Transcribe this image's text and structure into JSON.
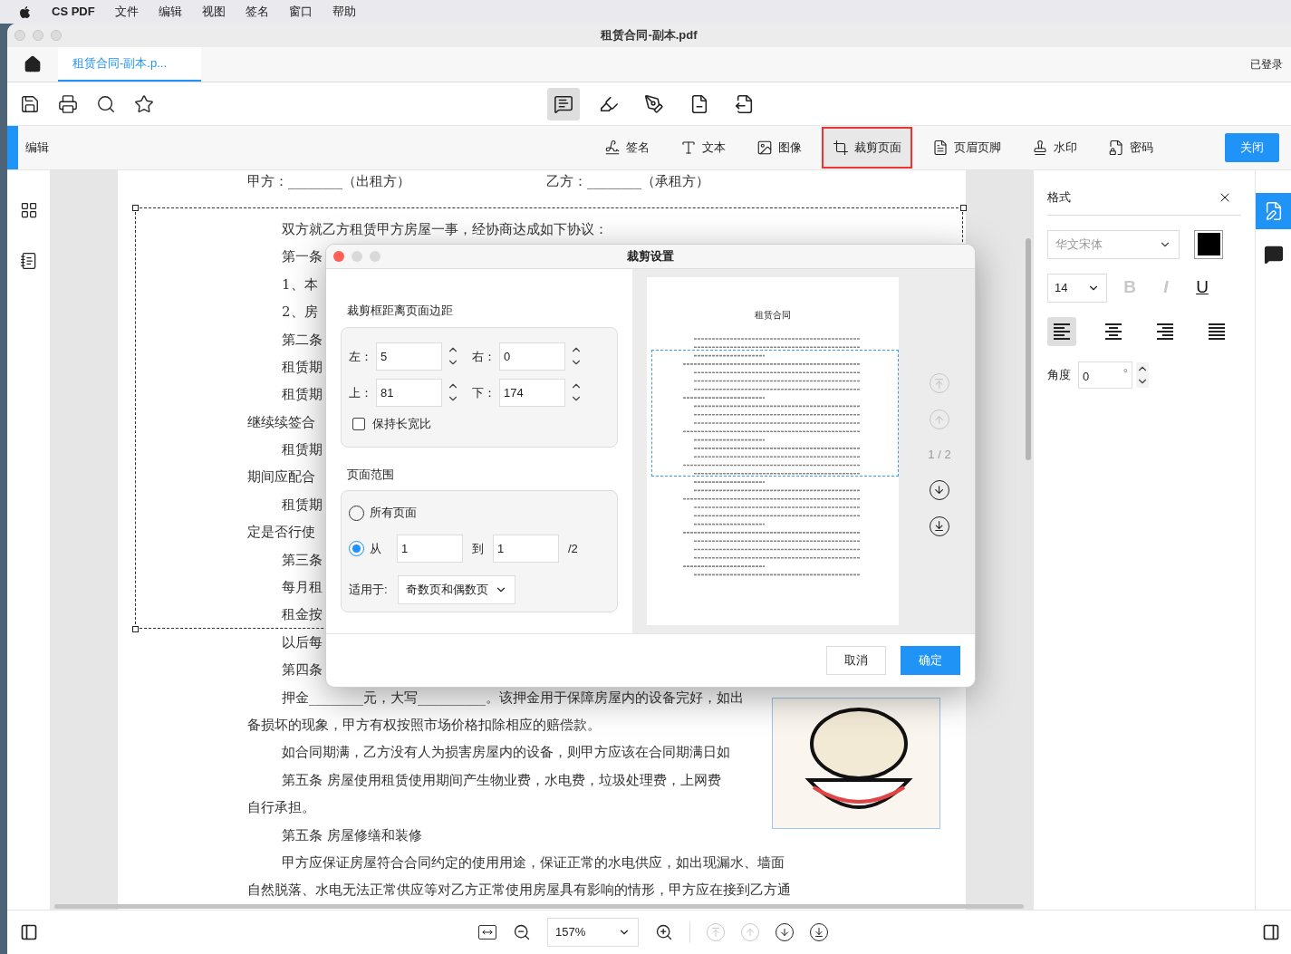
{
  "menu_bar": {
    "app": "CS PDF",
    "items": [
      "文件",
      "编辑",
      "视图",
      "签名",
      "窗口",
      "帮助"
    ]
  },
  "window": {
    "title": "租赁合同-副本.pdf"
  },
  "tabs": [
    {
      "label": "租赁合同-副本.p...",
      "selected": true
    }
  ],
  "account": "已登录",
  "toolbar": {
    "mode_tools": [
      {
        "kind": "comment",
        "selected": true
      },
      {
        "kind": "highlight",
        "selected": false
      },
      {
        "kind": "pen",
        "selected": false
      },
      {
        "kind": "page-remove",
        "selected": false
      },
      {
        "kind": "page-export",
        "selected": false
      }
    ]
  },
  "edit_bar": {
    "label": "编辑",
    "tools": [
      {
        "kind": "signature",
        "label": "签名",
        "selected": false
      },
      {
        "kind": "text",
        "label": "文本",
        "selected": false
      },
      {
        "kind": "image",
        "label": "图像",
        "selected": false
      },
      {
        "kind": "crop",
        "label": "裁剪页面",
        "selected": true
      },
      {
        "kind": "header",
        "label": "页眉页脚",
        "selected": false
      },
      {
        "kind": "watermark",
        "label": "水印",
        "selected": false
      },
      {
        "kind": "password",
        "label": "密码",
        "selected": false
      }
    ],
    "close": "关闭"
  },
  "document": {
    "party_a": "甲方：________（出租方）",
    "party_b": "乙方：________（承租方）",
    "lines": [
      {
        "text": "双方就乙方租赁甲方房屋一事，经协商达成如下协议：",
        "indent": true
      },
      {
        "text": "第一条",
        "indent": true
      },
      {
        "text": "1、本",
        "indent": true
      },
      {
        "text": "2、房",
        "indent": true
      },
      {
        "text": "第二条",
        "indent": true
      },
      {
        "text": "租赁期",
        "indent": true
      },
      {
        "text": "租赁期",
        "indent": true
      },
      {
        "text": "继续续签合",
        "indent": false
      },
      {
        "text": "租赁期",
        "indent": true
      },
      {
        "text": "期间应配合",
        "indent": false
      },
      {
        "text": "租赁期",
        "indent": true
      },
      {
        "text": "定是否行使",
        "indent": false
      },
      {
        "text": "第三条",
        "indent": true
      },
      {
        "text": "每月租",
        "indent": true
      },
      {
        "text": "租金按",
        "indent": true
      },
      {
        "text": "以后每",
        "indent": true
      },
      {
        "text": "第四条",
        "indent": true
      },
      {
        "text": "押金________元，大写__________。该押金用于保障房屋内的设备完好，如出",
        "indent": true
      },
      {
        "text": "备损坏的现象，甲方有权按照市场价格扣除相应的赔偿款。",
        "indent": false
      },
      {
        "text": "如合同期满，乙方没有人为损害房屋内的设备，则甲方应该在合同期满日如",
        "indent": true
      },
      {
        "text": "第五条  房屋使用租赁使用期间产生物业费，水电费，垃圾处理费，上网费",
        "indent": true
      },
      {
        "text": "自行承担。",
        "indent": false
      },
      {
        "text": "第五条  房屋修缮和装修",
        "indent": true
      },
      {
        "text": "甲方应保证房屋符合合同约定的使用用途，保证正常的水电供应，如出现漏水、墙面",
        "indent": true
      },
      {
        "text": "自然脱落、水电无法正常供应等对乙方正常使用房屋具有影响的情形，甲方应在接到乙方通",
        "indent": false
      }
    ]
  },
  "crop_dialog": {
    "title": "裁剪设置",
    "margins_heading": "裁剪框距离页面边距",
    "margins": [
      {
        "label": "左：",
        "value": "5"
      },
      {
        "label": "右：",
        "value": "0"
      },
      {
        "label": "上：",
        "value": "81"
      },
      {
        "label": "下：",
        "value": "174"
      }
    ],
    "keep_ratio": {
      "label": "保持长宽比",
      "checked": false
    },
    "range_heading": "页面范围",
    "all_pages": {
      "label": "所有页面",
      "selected": false
    },
    "from": {
      "label": "从",
      "selected": true,
      "value": "1"
    },
    "to": {
      "label": "到",
      "value": "1"
    },
    "total": "/2",
    "apply_to": {
      "label": "适用于:",
      "value": "奇数页和偶数页"
    },
    "preview": {
      "title": "租赁合同"
    },
    "page_indicator": "1 / 2",
    "nav": [
      {
        "kind": "first",
        "disabled": true
      },
      {
        "kind": "previous",
        "disabled": true
      },
      {
        "kind": "next",
        "disabled": false
      },
      {
        "kind": "last",
        "disabled": false
      }
    ],
    "cancel": "取消",
    "ok": "确定"
  },
  "format_panel": {
    "title": "格式",
    "font": {
      "placeholder": "华文宋体"
    },
    "size": "14",
    "styles": [
      {
        "kind": "bold",
        "label": "B",
        "on": false
      },
      {
        "kind": "italic",
        "label": "I",
        "on": false
      },
      {
        "kind": "underline",
        "label": "U",
        "on": true
      }
    ],
    "align": [
      {
        "kind": "left",
        "selected": true
      },
      {
        "kind": "center",
        "selected": false
      },
      {
        "kind": "right",
        "selected": false
      },
      {
        "kind": "justify",
        "selected": false
      }
    ],
    "angle": {
      "label": "角度",
      "value": "0",
      "unit": "°"
    }
  },
  "side_rail": [
    {
      "kind": "edit",
      "selected": true
    },
    {
      "kind": "comment",
      "selected": false
    }
  ],
  "status_bar": {
    "zoom": "157%",
    "nav": [
      {
        "kind": "first",
        "disabled": true
      },
      {
        "kind": "previous",
        "disabled": true
      },
      {
        "kind": "next",
        "disabled": false
      },
      {
        "kind": "last",
        "disabled": false
      }
    ]
  }
}
